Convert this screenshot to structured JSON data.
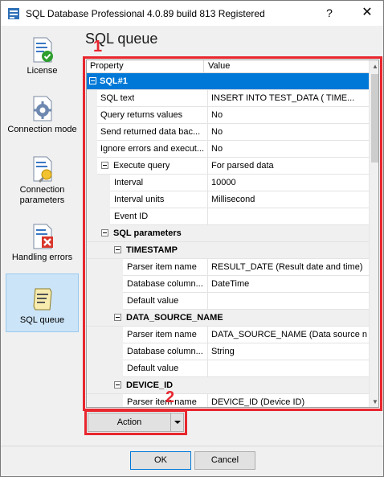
{
  "window": {
    "title": "SQL Database Professional 4.0.89 build 813 Registered",
    "help": "?",
    "close": "✕"
  },
  "sidebar": {
    "items": [
      {
        "label": "License",
        "icon": "license-icon"
      },
      {
        "label": "Connection mode",
        "icon": "connection-mode-icon"
      },
      {
        "label": "Connection parameters",
        "icon": "connection-parameters-icon"
      },
      {
        "label": "Handling errors",
        "icon": "handling-errors-icon"
      },
      {
        "label": "SQL queue",
        "icon": "sql-queue-icon",
        "selected": true
      }
    ]
  },
  "page": {
    "title": "SQL queue"
  },
  "grid": {
    "header": {
      "property": "Property",
      "value": "Value"
    },
    "rows": [
      {
        "name": "SQL#1",
        "value": "",
        "kind": "category-selected"
      },
      {
        "name": "SQL text",
        "value": "INSERT INTO TEST_DATA (    TIME..."
      },
      {
        "name": "Query returns values",
        "value": "No"
      },
      {
        "name": "Send returned data bac...",
        "value": "No"
      },
      {
        "name": "Ignore errors and execut...",
        "value": "No"
      },
      {
        "name": "Execute query",
        "value": "For parsed data"
      },
      {
        "name": "Interval",
        "value": "10000"
      },
      {
        "name": "Interval units",
        "value": "Millisecond"
      },
      {
        "name": "Event ID",
        "value": ""
      },
      {
        "name": "SQL parameters",
        "value": ""
      },
      {
        "name": "TIMESTAMP",
        "value": ""
      },
      {
        "name": "Parser item name",
        "value": "RESULT_DATE (Result date and time)"
      },
      {
        "name": "Database column...",
        "value": "DateTime"
      },
      {
        "name": "Default value",
        "value": ""
      },
      {
        "name": "DATA_SOURCE_NAME",
        "value": ""
      },
      {
        "name": "Parser item name",
        "value": "DATA_SOURCE_NAME (Data source n..."
      },
      {
        "name": "Database column...",
        "value": "String"
      },
      {
        "name": "Default value",
        "value": ""
      },
      {
        "name": "DEVICE_ID",
        "value": ""
      },
      {
        "name": "Parser item name",
        "value": "DEVICE_ID (Device ID)"
      }
    ]
  },
  "callouts": {
    "one": "1",
    "two": "2"
  },
  "action": {
    "label": "Action"
  },
  "buttons": {
    "ok": "OK",
    "cancel": "Cancel"
  },
  "colors": {
    "accent": "#0078d7",
    "callout": "#e8262e",
    "selected_sidebar": "#cce4f7"
  }
}
